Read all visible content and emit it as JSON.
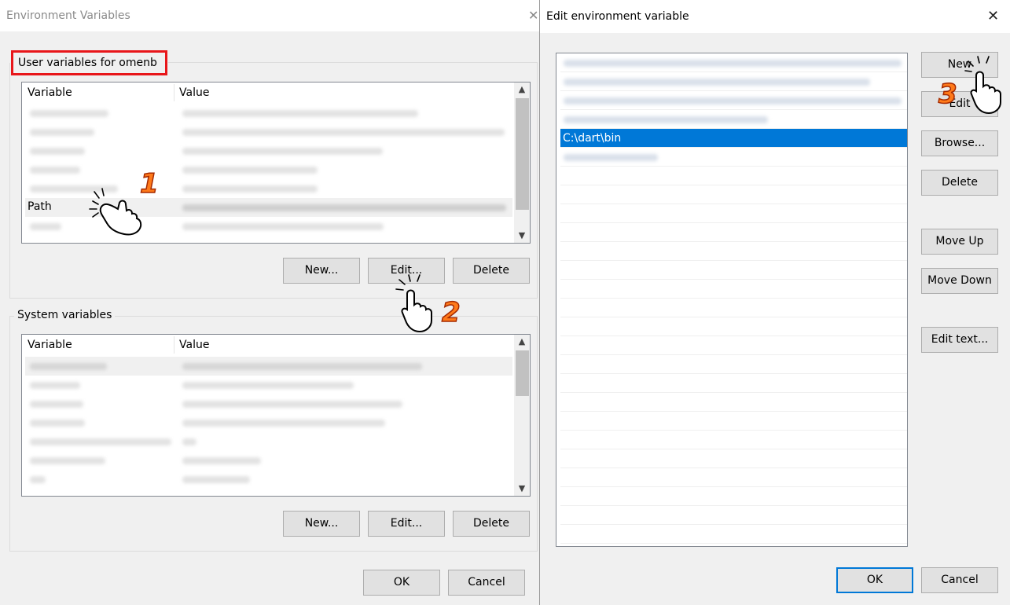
{
  "env_dialog": {
    "title": "Environment Variables",
    "close_glyph": "✕",
    "user_vars": {
      "label": "User variables for omenb",
      "columns": [
        "Variable",
        "Value"
      ],
      "visible_rows": [
        {
          "name": "",
          "blurred": true
        },
        {
          "name": "",
          "blurred": true
        },
        {
          "name": "",
          "blurred": true
        },
        {
          "name": "",
          "blurred": true
        },
        {
          "name": "",
          "blurred": true
        },
        {
          "name": "Path",
          "blurred_value": true,
          "selected": true
        },
        {
          "name": "",
          "blurred": true
        }
      ],
      "buttons": {
        "new": "New...",
        "edit": "Edit...",
        "delete": "Delete"
      }
    },
    "system_vars": {
      "label": "System variables",
      "columns": [
        "Variable",
        "Value"
      ],
      "buttons": {
        "new": "New...",
        "edit": "Edit...",
        "delete": "Delete"
      }
    },
    "footer": {
      "ok": "OK",
      "cancel": "Cancel"
    }
  },
  "edit_dialog": {
    "title": "Edit environment variable",
    "close_glyph": "✕",
    "entries": [
      {
        "text": "",
        "blurred": true
      },
      {
        "text": "",
        "blurred": true
      },
      {
        "text": "",
        "blurred": true
      },
      {
        "text": "",
        "blurred": true
      },
      {
        "text": "C:\\dart\\bin",
        "selected": true
      },
      {
        "text": "",
        "blurred": true
      }
    ],
    "buttons": {
      "new": "New",
      "edit": "Edit",
      "browse": "Browse...",
      "delete": "Delete",
      "move_up": "Move Up",
      "move_down": "Move Down",
      "edit_text": "Edit text..."
    },
    "footer": {
      "ok": "OK",
      "cancel": "Cancel"
    }
  },
  "annotations": {
    "step1": "1",
    "step2": "2",
    "step3": "3"
  },
  "colors": {
    "highlight_box": "#e8161a",
    "selection": "#0078d7",
    "step_fill": "#ff7a1a"
  },
  "icons": [
    "pointing-hand-icon",
    "close-icon",
    "scroll-up-arrow-icon",
    "scroll-down-arrow-icon"
  ]
}
